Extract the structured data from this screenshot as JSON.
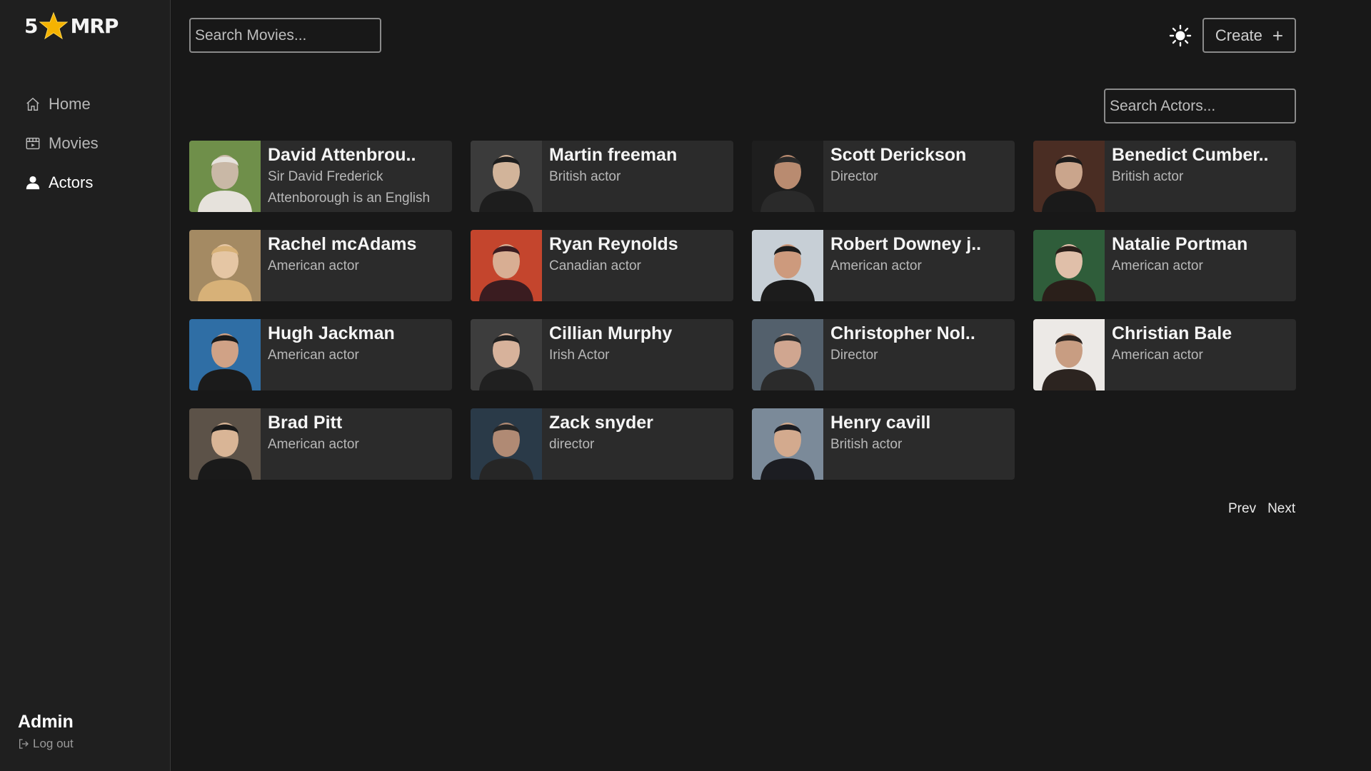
{
  "app": {
    "logo_left": "5",
    "logo_right": "MRP"
  },
  "sidebar": {
    "items": [
      {
        "label": "Home",
        "icon": "home-icon"
      },
      {
        "label": "Movies",
        "icon": "film-icon"
      },
      {
        "label": "Actors",
        "icon": "user-icon",
        "active": true
      }
    ],
    "user": "Admin",
    "logout_label": "Log out"
  },
  "header": {
    "search_movies_placeholder": "Search Movies...",
    "create_label": "Create",
    "create_icon": "plus-icon",
    "theme_icon": "sun-icon"
  },
  "actors": {
    "search_placeholder": "Search Actors...",
    "items": [
      {
        "name": "David Attenbrou..",
        "desc": "Sir David Frederick Attenborough is an English"
      },
      {
        "name": "Martin freeman",
        "desc": "British actor"
      },
      {
        "name": "Scott Derickson",
        "desc": "Director"
      },
      {
        "name": "Benedict Cumber..",
        "desc": "British actor"
      },
      {
        "name": "Rachel mcAdams",
        "desc": "American actor"
      },
      {
        "name": "Ryan Reynolds",
        "desc": "Canadian actor"
      },
      {
        "name": "Robert Downey j..",
        "desc": "American actor"
      },
      {
        "name": "Natalie Portman",
        "desc": "American actor"
      },
      {
        "name": "Hugh Jackman",
        "desc": "American actor"
      },
      {
        "name": "Cillian Murphy",
        "desc": "Irish Actor"
      },
      {
        "name": "Christopher Nol..",
        "desc": "Director"
      },
      {
        "name": "Christian Bale",
        "desc": "American actor"
      },
      {
        "name": "Brad Pitt",
        "desc": "American actor"
      },
      {
        "name": "Zack snyder",
        "desc": "director"
      },
      {
        "name": "Henry cavill",
        "desc": "British actor"
      }
    ]
  },
  "pagination": {
    "prev_label": "Prev",
    "next_label": "Next"
  },
  "colors": {
    "background": "#181818",
    "sidebar": "#1f1f1f",
    "card": "#2b2b2b",
    "logo_star": "#f5b301"
  }
}
